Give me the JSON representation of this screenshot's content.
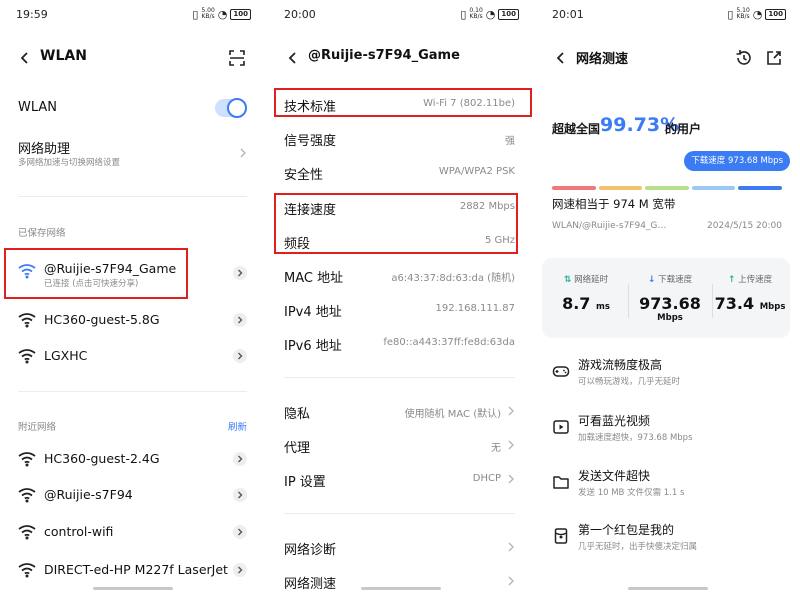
{
  "panel1": {
    "time": "19:59",
    "status_net": "5.00\nKB/s",
    "battery": "100",
    "title": "WLAN",
    "wlan_label": "WLAN",
    "wlan_on": true,
    "assistant": {
      "label": "网络助理",
      "sub": "多网络加速与切换网络设置"
    },
    "saved_section": "已保存网络",
    "saved": [
      {
        "name": "@Ruijie-s7F94_Game",
        "sub": "已连接 (点击可快速分享)"
      },
      {
        "name": "HC360-guest-5.8G",
        "sub": ""
      },
      {
        "name": "LGXHC",
        "sub": ""
      }
    ],
    "nearby_section": "附近网络",
    "refresh": "刷新",
    "nearby": [
      {
        "name": "HC360-guest-2.4G"
      },
      {
        "name": "@Ruijie-s7F94"
      },
      {
        "name": "control-wifi"
      },
      {
        "name": "DIRECT-ed-HP M227f LaserJet"
      }
    ]
  },
  "panel2": {
    "time": "20:00",
    "status_net": "0.10\nKB/s",
    "battery": "100",
    "title": "@Ruijie-s7F94_Game",
    "details": [
      {
        "label": "技术标准",
        "value": "Wi-Fi 7 (802.11be)"
      },
      {
        "label": "信号强度",
        "value": "强"
      },
      {
        "label": "安全性",
        "value": "WPA/WPA2 PSK"
      },
      {
        "label": "连接速度",
        "value": "2882 Mbps"
      },
      {
        "label": "频段",
        "value": "5 GHz"
      },
      {
        "label": "MAC 地址",
        "value": "a6:43:37:8d:63:da (随机)"
      },
      {
        "label": "IPv4 地址",
        "value": "192.168.111.87"
      },
      {
        "label": "IPv6 地址",
        "value": "fe80::a443:37ff:fe8d:63da"
      }
    ],
    "settings": [
      {
        "label": "隐私",
        "value": "使用随机 MAC (默认)"
      },
      {
        "label": "代理",
        "value": "无"
      },
      {
        "label": "IP 设置",
        "value": "DHCP"
      }
    ],
    "tools": [
      {
        "label": "网络诊断"
      },
      {
        "label": "网络测速"
      }
    ]
  },
  "panel3": {
    "time": "20:01",
    "status_net": "5.10\nKB/s",
    "battery": "100",
    "title": "网络测速",
    "beat_prefix": "超越全国",
    "beat_pct": "99.73%",
    "beat_suffix": "的用户",
    "bubble": "下载速度 973.68 Mbps",
    "broadband": "网速相当于 974 M 宽带",
    "network": "WLAN/@Ruijie-s7F94_G…",
    "datetime": "2024/5/15 20:00",
    "speed_level": 5,
    "levels": 5,
    "level_colors": [
      "#f07a7a",
      "#f5c26b",
      "#b7e08a",
      "#9cc8f5",
      "#3b7cf5"
    ],
    "metrics": [
      {
        "label": "网络延时",
        "arrow": "⇅",
        "color": "#2ab39a",
        "value": "8.7",
        "unit": "ms"
      },
      {
        "label": "下载速度",
        "arrow": "↓",
        "color": "#3b7cf5",
        "value": "973.68",
        "unit": "Mbps"
      },
      {
        "label": "上传速度",
        "arrow": "↑",
        "color": "#2ab39a",
        "value": "73.4",
        "unit": "Mbps"
      }
    ],
    "features": [
      {
        "title": "游戏流畅度极高",
        "sub": "可以畅玩游戏，几乎无延时",
        "icon": "gamepad-icon"
      },
      {
        "title": "可看蓝光视频",
        "sub": "加载速度超快，973.68 Mbps",
        "icon": "play-video-icon"
      },
      {
        "title": "发送文件超快",
        "sub": "发送 10 MB 文件仅需 1.1 s",
        "icon": "folder-icon"
      },
      {
        "title": "第一个红包是我的",
        "sub": "几乎无延时，出手快傻决定归属",
        "icon": "red-envelope-icon"
      }
    ]
  }
}
